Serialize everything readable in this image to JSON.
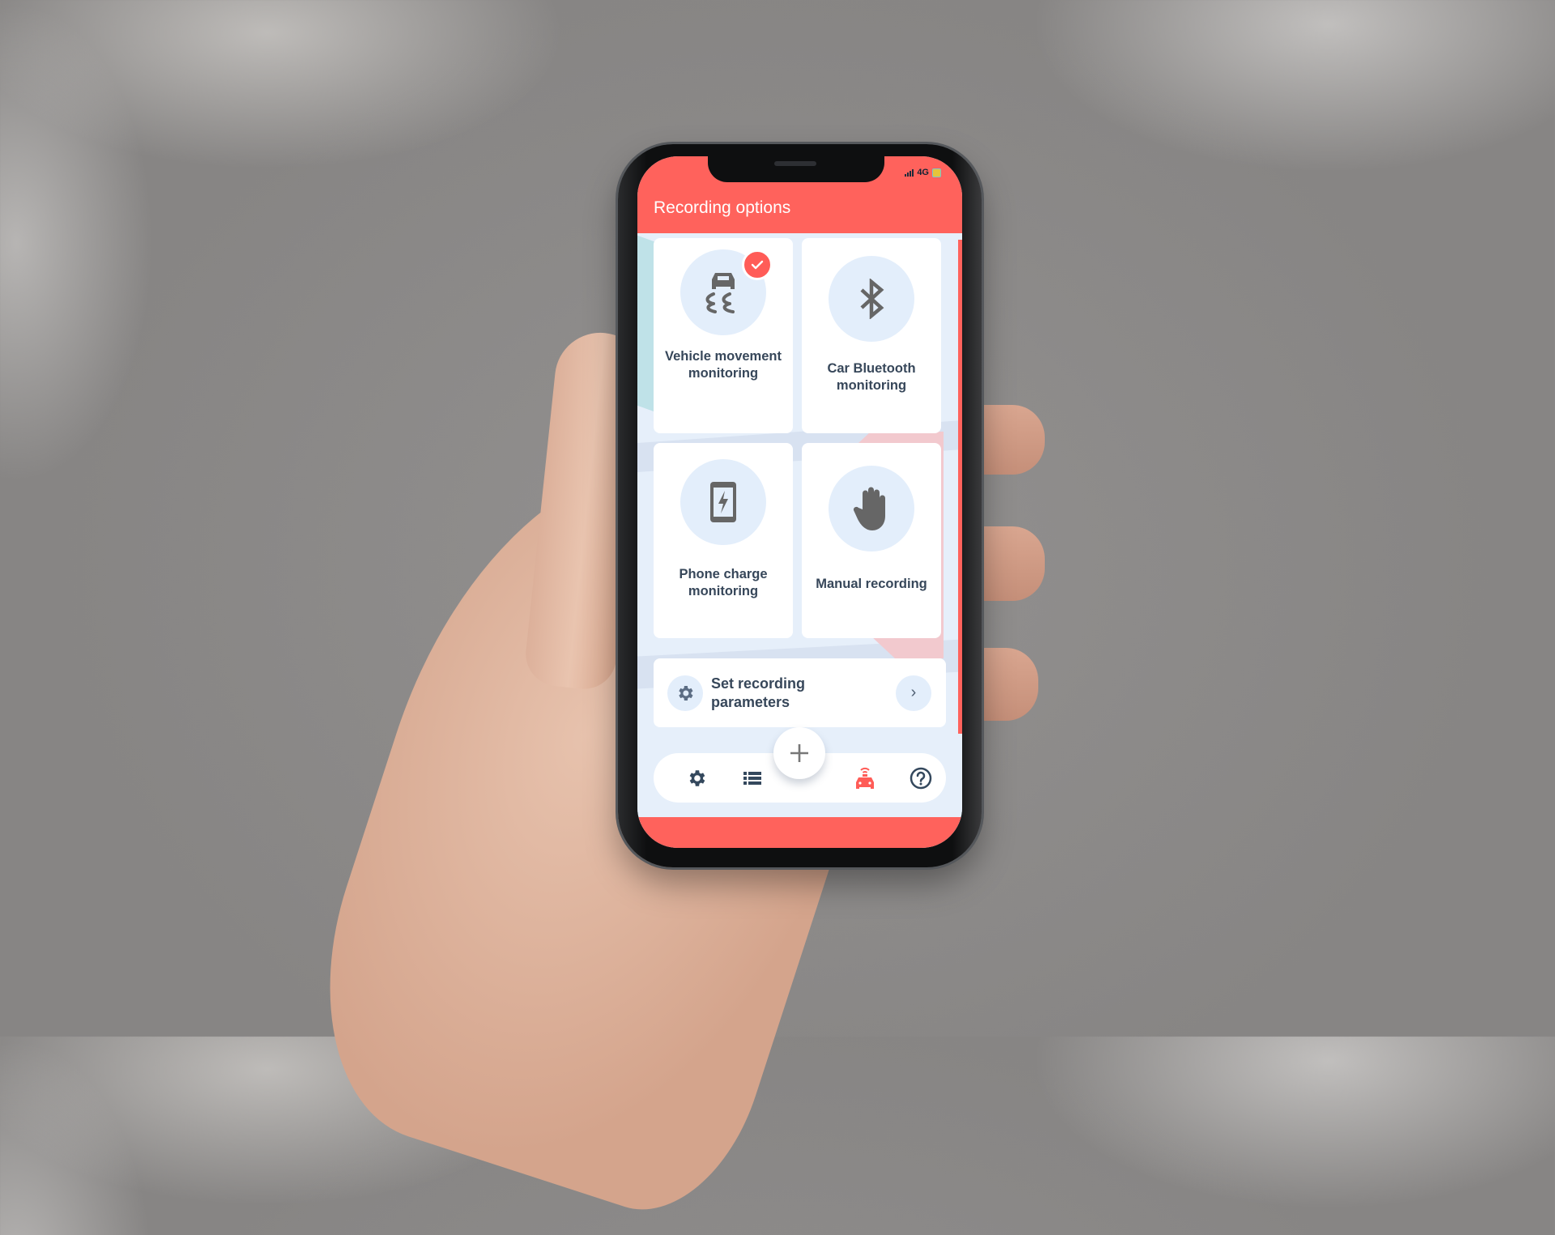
{
  "status_bar": {
    "network": "4G",
    "signal_icon": "signal-bars-icon",
    "battery_icon": "battery-icon"
  },
  "header": {
    "title": "Recording options"
  },
  "colors": {
    "accent": "#ff625c",
    "icon_circle": "#e3eefb",
    "label_text": "#37475a",
    "icon_gray": "#666666"
  },
  "options": [
    {
      "label": "Vehicle movement monitoring",
      "icon": "vehicle-skid-icon",
      "selected": true
    },
    {
      "label": "Car Bluetooth monitoring",
      "icon": "bluetooth-icon",
      "selected": false
    },
    {
      "label": "Phone charge monitoring",
      "icon": "phone-charging-icon",
      "selected": false
    },
    {
      "label": "Manual recording",
      "icon": "hand-icon",
      "selected": false
    }
  ],
  "settings_row": {
    "label": "Set recording parameters",
    "icon": "gear-icon",
    "action_icon": "chevron-right-icon",
    "chevron": "›"
  },
  "fab": {
    "icon": "plus-icon",
    "symbol": "+"
  },
  "bottom_nav": [
    {
      "name": "settings",
      "icon": "gear-icon",
      "active": false
    },
    {
      "name": "list",
      "icon": "list-icon",
      "active": false
    },
    {
      "name": "vehicle",
      "icon": "car-signal-icon",
      "active": true
    },
    {
      "name": "help",
      "icon": "help-icon",
      "active": false
    }
  ]
}
